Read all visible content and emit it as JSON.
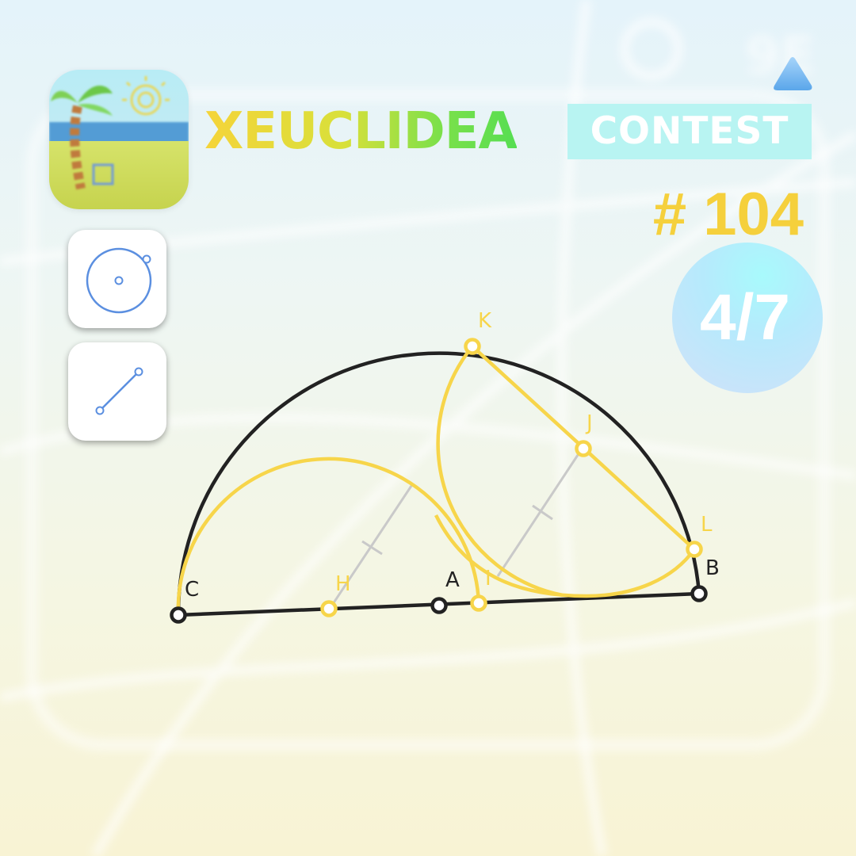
{
  "header": {
    "title": "XEUCLIDEA",
    "badge": "CONTEST",
    "puzzle_number": "# 104",
    "progress": "4/7"
  },
  "tools": [
    {
      "name": "Circle tool",
      "icon": "circle-tool-icon"
    },
    {
      "name": "Line tool",
      "icon": "line-tool-icon"
    }
  ],
  "figure": {
    "given_points": [
      "A",
      "B",
      "C"
    ],
    "constructed_points": [
      "H",
      "I",
      "J",
      "K",
      "L"
    ]
  },
  "colors": {
    "given": "#222222",
    "constructed": "#f7d54a",
    "helper": "#c9c9c9",
    "tool_icon": "#5b8fe0"
  }
}
